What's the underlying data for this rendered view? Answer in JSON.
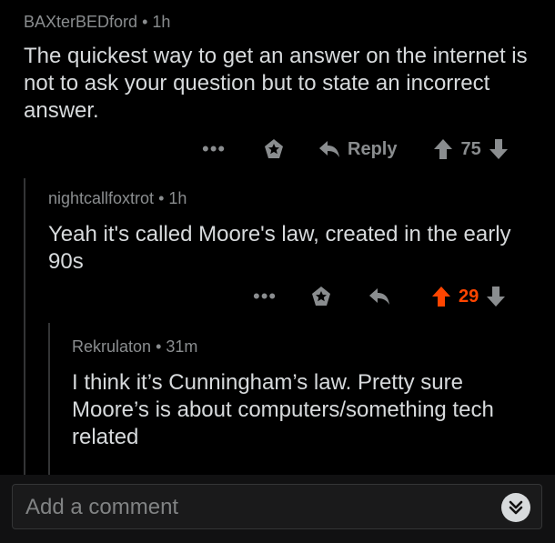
{
  "comments": [
    {
      "author": "BAXterBEDford",
      "time": "1h",
      "text": "The quickest way to get an answer on the internet is not to ask your question but to state an incorrect answer.",
      "more_label": "•••",
      "reply_label": "Reply",
      "score": "75",
      "upvoted": false
    },
    {
      "author": "nightcallfoxtrot",
      "time": "1h",
      "text": "Yeah it's called Moore's law, created in the early 90s",
      "more_label": "•••",
      "score": "29",
      "upvoted": true
    },
    {
      "author": "Rekrulaton",
      "time": "31m",
      "text": "I think it’s Cunningham’s law. Pretty sure Moore’s is about computers/something tech related"
    }
  ],
  "separator": "•",
  "composer": {
    "placeholder": "Add a comment"
  },
  "colors": {
    "background": "#000000",
    "text": "#d7dadc",
    "muted": "#8a8d8f",
    "upvote_active": "#ff4500"
  },
  "icons": {
    "more": "more-options-icon",
    "award": "award-icon",
    "reply": "reply-arrow-icon",
    "upvote": "upvote-arrow-icon",
    "downvote": "downvote-arrow-icon",
    "expand": "double-chevron-down-icon"
  }
}
